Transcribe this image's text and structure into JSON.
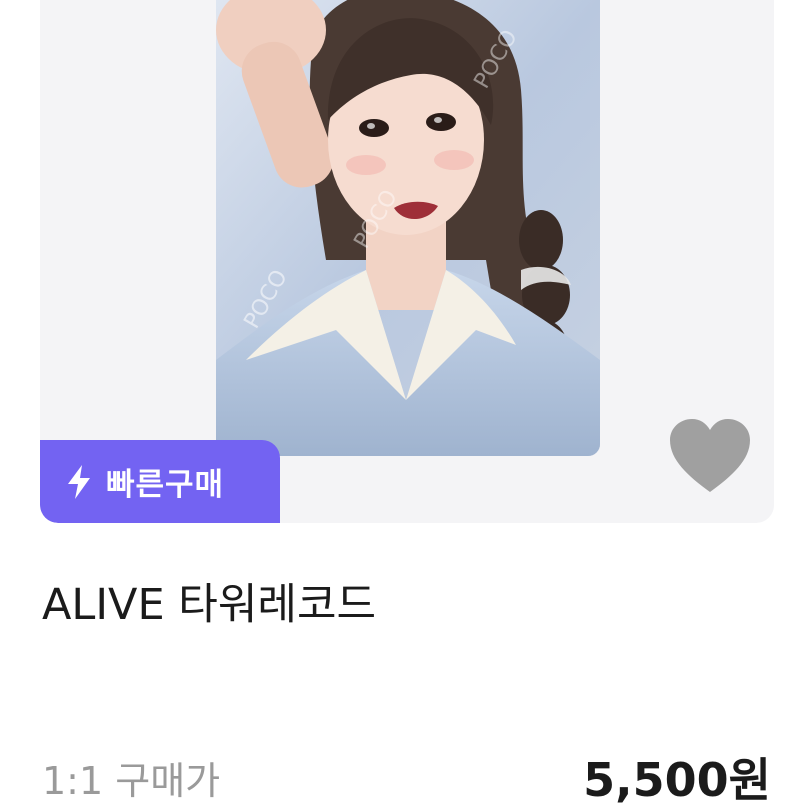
{
  "listing": {
    "badge_label": "빠른구매",
    "badge_icon": "lightning-bolt-icon",
    "favorite_icon": "heart-icon",
    "title": "ALIVE 타워레코드",
    "price_label": "1:1 구매가",
    "price": "5,500원"
  },
  "photo": {
    "watermark": "POCO"
  },
  "colors": {
    "card_background": "#f4f4f6",
    "badge_background": "#7363f2",
    "heart": "#a0a0a0",
    "title_text": "#1b1b1b",
    "muted_text": "#9a9a9a"
  }
}
